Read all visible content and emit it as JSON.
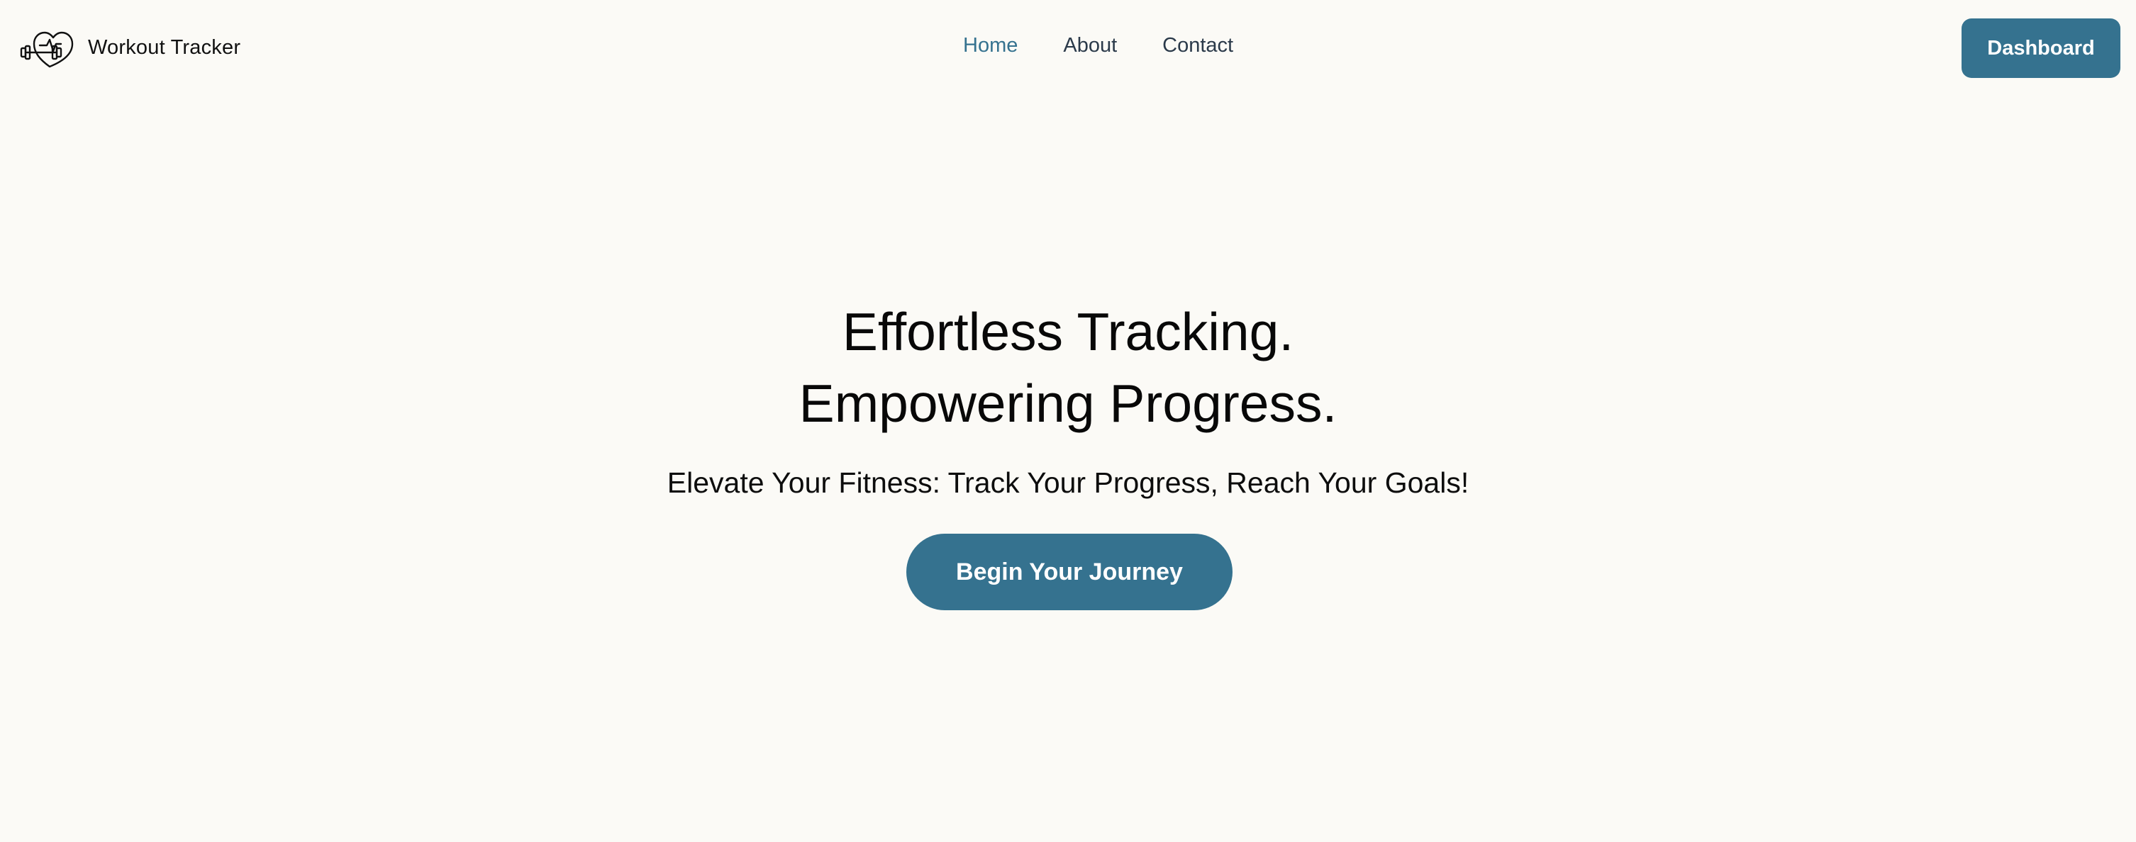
{
  "header": {
    "brand": {
      "name": "Workout Tracker",
      "logo_icon": "heart-dumbbell-icon"
    },
    "nav": [
      {
        "label": "Home",
        "active": true
      },
      {
        "label": "About",
        "active": false
      },
      {
        "label": "Contact",
        "active": false
      }
    ],
    "dashboard_label": "Dashboard"
  },
  "hero": {
    "title_line1": "Effortless Tracking.",
    "title_line2": "Empowering Progress.",
    "subtitle": "Elevate Your Fitness: Track Your Progress, Reach Your Goals!",
    "cta_label": "Begin Your Journey"
  },
  "colors": {
    "background": "#fbfaf6",
    "accent": "#35728f",
    "nav_text": "#2b3a4a",
    "text": "#0d0d0d"
  }
}
